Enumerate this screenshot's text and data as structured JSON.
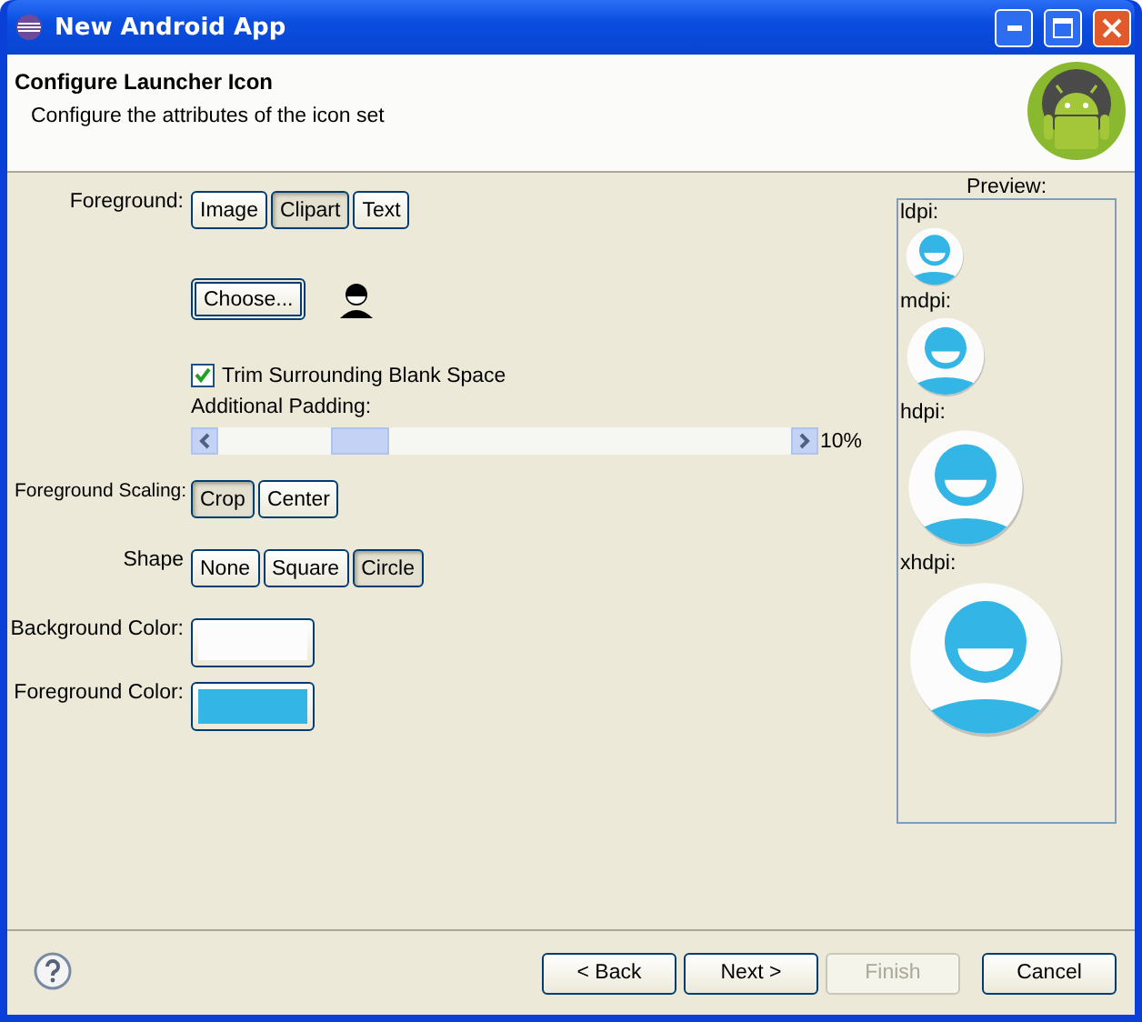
{
  "window": {
    "title": "New Android App"
  },
  "header": {
    "title": "Configure Launcher Icon",
    "description": "Configure the attributes of the icon set"
  },
  "foreground": {
    "label": "Foreground:",
    "options": [
      {
        "label": "Image",
        "selected": false
      },
      {
        "label": "Clipart",
        "selected": true
      },
      {
        "label": "Text",
        "selected": false
      }
    ]
  },
  "choose_button": "Choose...",
  "trim": {
    "label": "Trim Surrounding Blank Space",
    "checked": true
  },
  "padding": {
    "label": "Additional Padding:",
    "level": 0.22,
    "reading": "10%"
  },
  "scaling": {
    "label": "Foreground Scaling:",
    "options": [
      {
        "label": "Crop",
        "selected": true
      },
      {
        "label": "Center",
        "selected": false
      }
    ]
  },
  "shape": {
    "label": "Shape",
    "options": [
      {
        "label": "None",
        "selected": false
      },
      {
        "label": "Square",
        "selected": false
      },
      {
        "label": "Circle",
        "selected": true
      }
    ]
  },
  "background_color": {
    "label": "Background Color:",
    "color": "#fcfcfc"
  },
  "foreground_color": {
    "label": "Foreground Color:",
    "color": "#33b5e5"
  },
  "preview": {
    "title": "Preview:",
    "densities": [
      {
        "label": "ldpi:"
      },
      {
        "label": "mdpi:"
      },
      {
        "label": "hdpi:"
      },
      {
        "label": "xhdpi:"
      }
    ]
  },
  "buttons": [
    {
      "label": "< Back",
      "disabled": false
    },
    {
      "label": "Next >",
      "disabled": false
    },
    {
      "label": "Finish",
      "disabled": true
    },
    {
      "label": "Cancel",
      "disabled": false
    }
  ]
}
